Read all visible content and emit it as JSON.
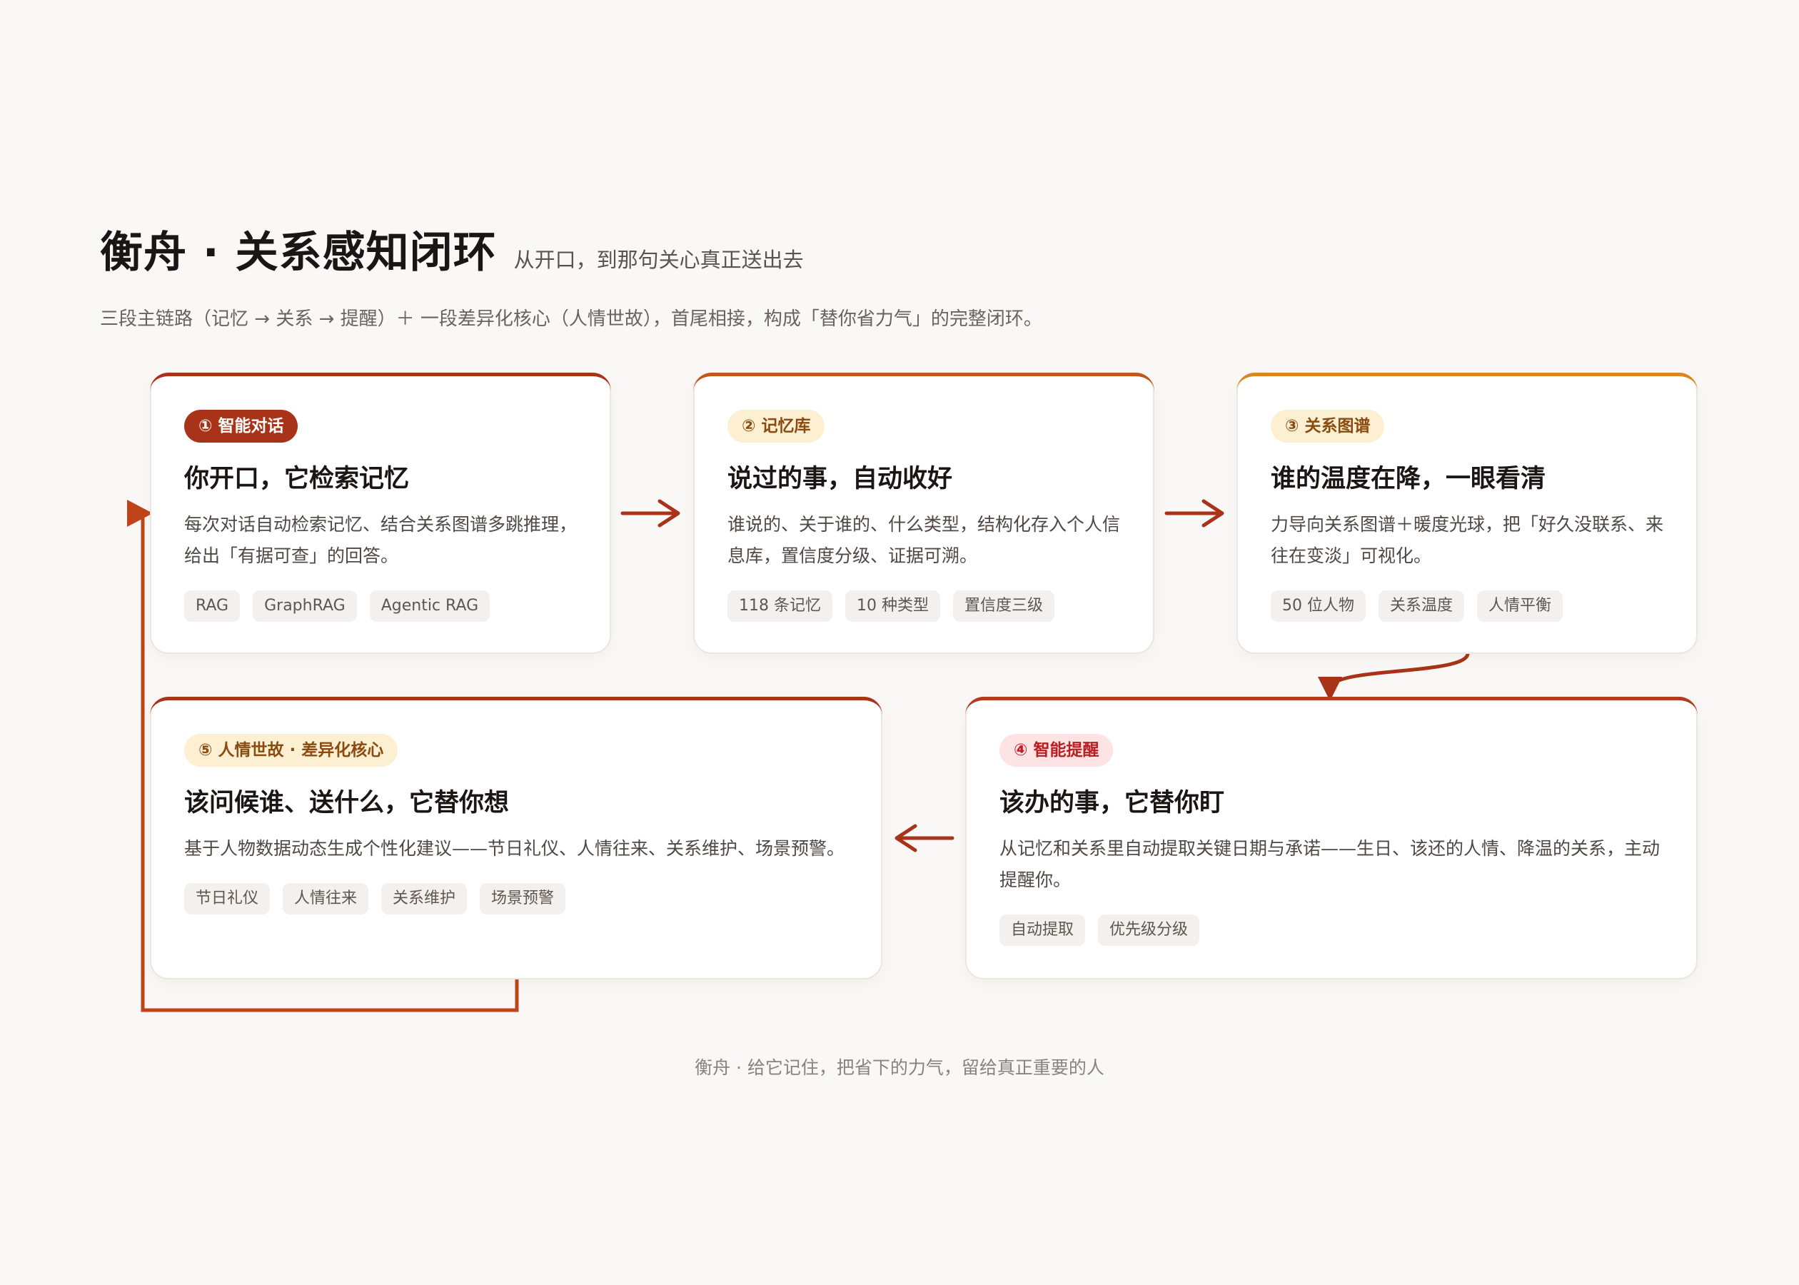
{
  "header": {
    "title": "衡舟 · 关系感知闭环",
    "tagline": "从开口，到那句关心真正送出去",
    "subtitle": "三段主链路（记忆 → 关系 → 提醒）＋ 一段差异化核心（人情世故），首尾相接，构成「替你省力气」的完整闭环。"
  },
  "cards": [
    {
      "badge": "① 智能对话",
      "title": "你开口，它检索记忆",
      "desc": "每次对话自动检索记忆、结合关系图谱多跳推理，给出「有据可查」的回答。",
      "tags": [
        "RAG",
        "GraphRAG",
        "Agentic RAG"
      ],
      "accent": "#a83318",
      "badge_bg": "#a83318",
      "badge_fg": "#ffffff"
    },
    {
      "badge": "② 记忆库",
      "title": "说过的事，自动收好",
      "desc": "谁说的、关于谁的、什么类型，结构化存入个人信息库，置信度分级、证据可溯。",
      "tags": [
        "118 条记忆",
        "10 种类型",
        "置信度三级"
      ],
      "accent": "#c2571a",
      "badge_bg": "#fdf0d2",
      "badge_fg": "#8a4a10"
    },
    {
      "badge": "③ 关系图谱",
      "title": "谁的温度在降，一眼看清",
      "desc": "力导向关系图谱＋暖度光球，把「好久没联系、来往在变淡」可视化。",
      "tags": [
        "50 位人物",
        "关系温度",
        "人情平衡"
      ],
      "accent": "#dd861f",
      "badge_bg": "#fdf0d2",
      "badge_fg": "#8a4a10"
    },
    {
      "badge": "④ 智能提醒",
      "title": "该办的事，它替你盯",
      "desc": "从记忆和关系里自动提取关键日期与承诺——生日、该还的人情、降温的关系，主动提醒你。",
      "tags": [
        "自动提取",
        "优先级分级"
      ],
      "accent": "#b5391c",
      "badge_bg": "#fde3e3",
      "badge_fg": "#b81f23"
    },
    {
      "badge": "⑤ 人情世故 · 差异化核心",
      "title": "该问候谁、送什么，它替你想",
      "desc": "基于人物数据动态生成个性化建议——节日礼仪、人情往来、关系维护、场景预警。",
      "tags": [
        "节日礼仪",
        "人情往来",
        "关系维护",
        "场景预警"
      ],
      "accent": "#a83318",
      "badge_bg": "#fdf0d2",
      "badge_fg": "#8a4a10"
    }
  ],
  "colors": {
    "arrow": "#a83318",
    "loop": "#c0441a"
  },
  "footer": "衡舟 · 给它记住，把省下的力气，留给真正重要的人"
}
